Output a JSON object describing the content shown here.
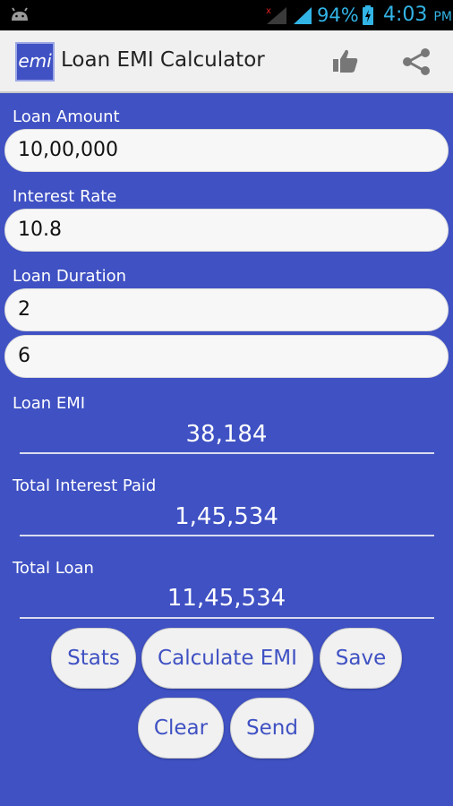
{
  "status_bar": {
    "battery_percent": "94%",
    "time": "4:03",
    "ampm": "PM"
  },
  "app_bar": {
    "logo_text": "emi",
    "title": "Loan EMI Calculator",
    "like_icon": "thumbs-up-icon",
    "share_icon": "share-icon"
  },
  "form": {
    "loan_amount": {
      "label": "Loan Amount",
      "value": "10,00,000"
    },
    "interest_rate": {
      "label": "Interest Rate",
      "value": "10.8"
    },
    "loan_duration": {
      "label": "Loan Duration",
      "years": "2",
      "months": "6"
    }
  },
  "results": {
    "loan_emi": {
      "label": "Loan EMI",
      "value": "38,184"
    },
    "total_interest": {
      "label": "Total Interest Paid",
      "value": "1,45,534"
    },
    "total_loan": {
      "label": "Total Loan",
      "value": "11,45,534"
    }
  },
  "buttons": {
    "stats": "Stats",
    "calculate": "Calculate EMI",
    "save": "Save",
    "clear": "Clear",
    "send": "Send"
  },
  "colors": {
    "background": "#3F51C3",
    "status_accent": "#32b4e6"
  }
}
